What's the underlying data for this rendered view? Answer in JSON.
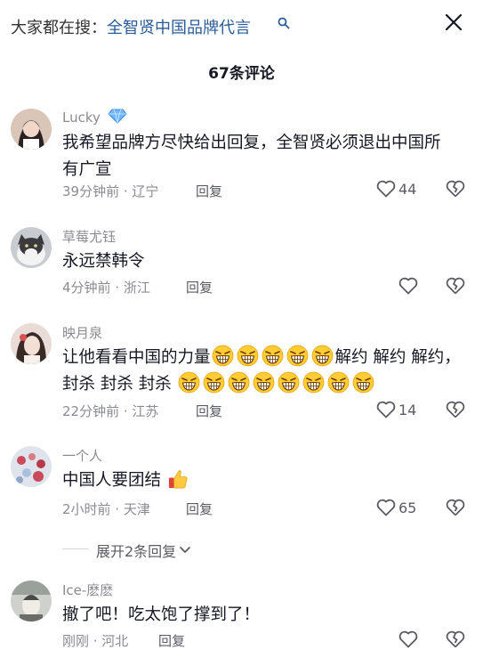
{
  "search": {
    "prefix": "大家都在搜：",
    "query": "全智贤中国品牌代言"
  },
  "comment_count_label": "67条评论",
  "comments": [
    {
      "username": "Lucky",
      "text": "我希望品牌方尽快给出回复，全智贤必须退出中国所有广宣",
      "time_location": "39分钟前 · 辽宁",
      "reply_label": "回复",
      "like_count": "44"
    },
    {
      "username": "草莓尤钰",
      "text": "永远禁韩令",
      "time_location": "4分钟前 · 浙江",
      "reply_label": "回复",
      "like_count": ""
    },
    {
      "username": "映月泉",
      "text_part1": "让他看看中国的力量",
      "text_part2": "解约 解约 解约，封杀 封杀 封杀",
      "time_location": "22分钟前 · 江苏",
      "reply_label": "回复",
      "like_count": "14"
    },
    {
      "username": "一个人",
      "text": "中国人要团结",
      "time_location": "2小时前 · 天津",
      "reply_label": "回复",
      "like_count": "65"
    },
    {
      "username": "Ice-麽麽",
      "text": "撤了吧！吃太饱了撑到了！",
      "time_location": "刚刚 · 河北",
      "reply_label": "回复",
      "like_count": ""
    }
  ],
  "expand_replies_label": "展开2条回复",
  "icons": {
    "close": "close-icon",
    "search": "search-icon",
    "like": "heart-icon",
    "dislike": "broken-heart-icon",
    "badge": "diamond-icon",
    "emoji": "angry-grin-emoji",
    "thumbs": "thumbs-up-emoji",
    "chevron": "chevron-down-icon"
  },
  "colors": {
    "search_query": "#2b5b98",
    "username": "#8a8b91",
    "body_text": "#161823",
    "diamond": "#4fa3f7"
  }
}
